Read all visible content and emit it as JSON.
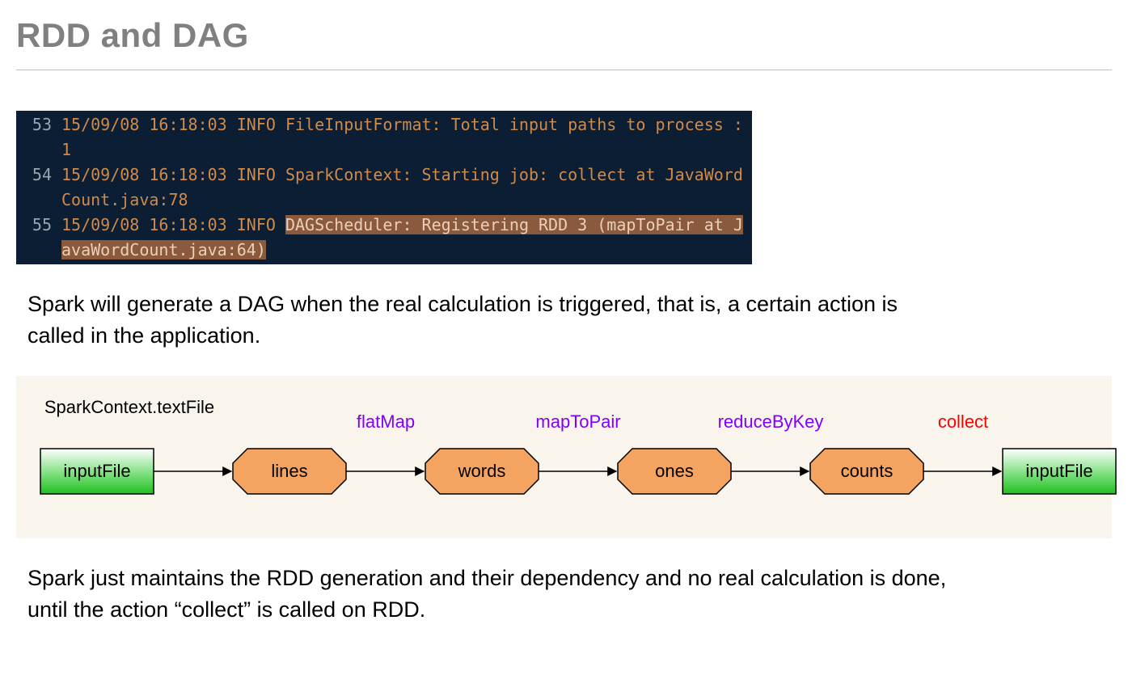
{
  "title": "RDD and DAG",
  "console": {
    "lines": [
      {
        "no": "53",
        "text": "15/09/08 16:18:03 INFO FileInputFormat: Total input paths to process : 1",
        "hl": ""
      },
      {
        "no": "54",
        "text": "15/09/08 16:18:03 INFO SparkContext: Starting job: collect at JavaWordCount.java:78",
        "hl": ""
      },
      {
        "no": "55",
        "text": "15/09/08 16:18:03 INFO ",
        "hl": "DAGScheduler: Registering RDD 3 (mapToPair at JavaWordCount.java:64)"
      }
    ]
  },
  "para1": "Spark will generate a DAG when the real calculation is triggered, that is, a certain action is called in the application.",
  "diagram": {
    "source_label": "SparkContext.textFile",
    "nodes": [
      {
        "label": "inputFile",
        "kind": "file"
      },
      {
        "label": "lines",
        "kind": "rdd"
      },
      {
        "label": "words",
        "kind": "rdd"
      },
      {
        "label": "ones",
        "kind": "rdd"
      },
      {
        "label": "counts",
        "kind": "rdd"
      },
      {
        "label": "inputFile",
        "kind": "file"
      }
    ],
    "edges": [
      {
        "label": "",
        "color": "#000000"
      },
      {
        "label": "flatMap",
        "color": "#8000ff"
      },
      {
        "label": "mapToPair",
        "color": "#8000ff"
      },
      {
        "label": "reduceByKey",
        "color": "#8000ff"
      },
      {
        "label": "collect",
        "color": "#ff0000"
      }
    ]
  },
  "para2": "Spark just maintains the RDD generation and their dependency and no real calculation is done, until the action “collect” is called on RDD."
}
